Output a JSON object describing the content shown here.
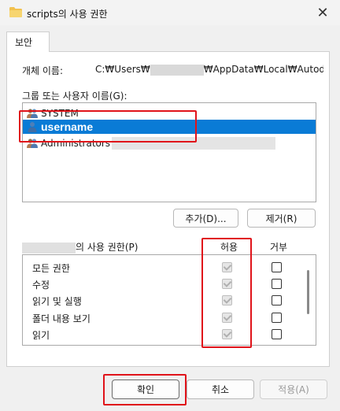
{
  "window": {
    "title": "scripts의 사용 권한",
    "close_symbol": "✕"
  },
  "tabs": [
    {
      "label": "보안"
    }
  ],
  "object": {
    "label": "개체 이름:",
    "path_prefix": "C:₩Users₩",
    "path_suffix": "₩AppData₩Local₩Autodesk₩"
  },
  "groups": {
    "label": "그룹 또는 사용자 이름(G):",
    "items": [
      {
        "name": "SYSTEM",
        "icon": "group-icon"
      },
      {
        "name": "username",
        "icon": "user-icon",
        "selected": true
      },
      {
        "name": "Administrators",
        "icon": "group-icon"
      }
    ]
  },
  "buttons": {
    "add": "추가(D)...",
    "remove": "제거(R)",
    "ok": "확인",
    "cancel": "취소",
    "apply": "적용(A)"
  },
  "permissions": {
    "label": "의 사용 권한(P)",
    "allow_header": "허용",
    "deny_header": "거부",
    "rows": [
      {
        "name": "모든 권한",
        "allow": true,
        "deny": false
      },
      {
        "name": "수정",
        "allow": true,
        "deny": false
      },
      {
        "name": "읽기 및 실행",
        "allow": true,
        "deny": false
      },
      {
        "name": "폴더 내용 보기",
        "allow": true,
        "deny": false
      },
      {
        "name": "읽기",
        "allow": true,
        "deny": false
      }
    ]
  },
  "colors": {
    "selection": "#0a7bd6",
    "highlight_box": "#e0131a"
  }
}
